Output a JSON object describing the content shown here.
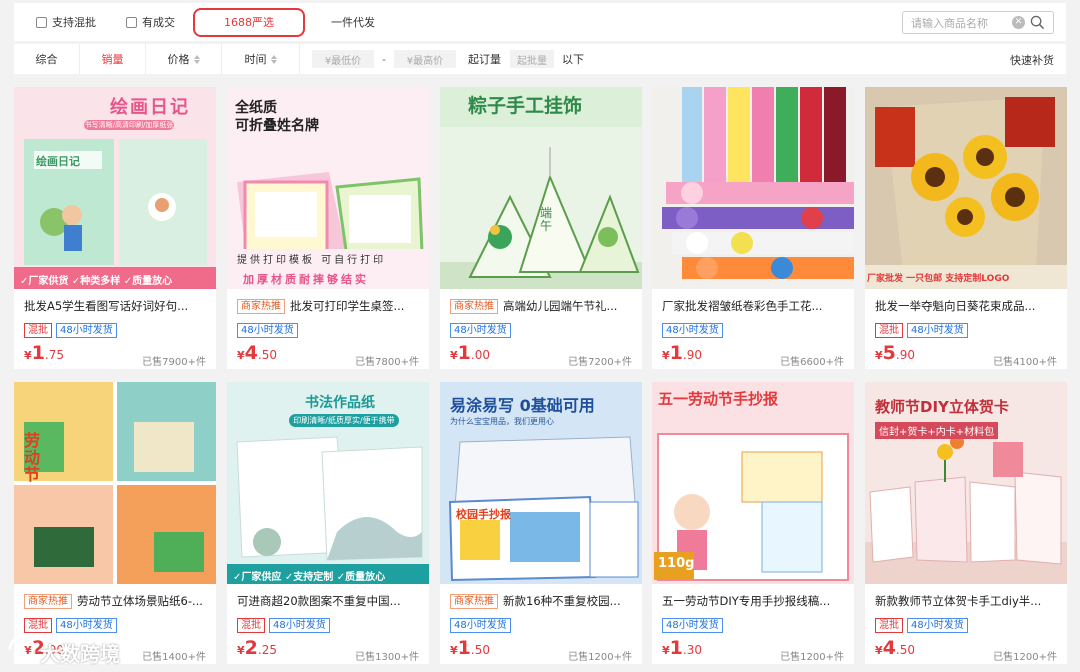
{
  "filters": {
    "mixed_batch": "支持混批",
    "has_deal": "有成交",
    "selected_tab": "1688严选",
    "dropship": "一件代发",
    "search_placeholder": "请输入商品名称"
  },
  "sort": {
    "comprehensive": "综合",
    "sales": "销量",
    "price": "价格",
    "time": "时间",
    "min_price": "¥最低价",
    "dash": "-",
    "max_price": "¥最高价",
    "moq_label": "起订量",
    "moq_placeholder": "起批量",
    "below": "以下",
    "quick_restock": "快速补货"
  },
  "products": [
    {
      "title": "批发A5学生看图写话好词好句...",
      "badge": "",
      "tags": [
        {
          "text": "混批",
          "color": "red"
        },
        {
          "text": "48小时发货",
          "color": "blue"
        }
      ],
      "price_int": "1",
      "price_dec": ".75",
      "sold": "已售7900+件",
      "image": {
        "heading": "绘画日记",
        "subtitle": "书写清晰/高清印刷/加厚纸张",
        "cover": "绘画日记",
        "footer": "✓厂家供货 ✓种类多样 ✓质量放心"
      }
    },
    {
      "title": "批发可打印学生桌签...",
      "badge": "商家热推",
      "tags": [
        {
          "text": "48小时发货",
          "color": "blue"
        }
      ],
      "price_int": "4",
      "price_dec": ".50",
      "sold": "已售7800+件",
      "image": {
        "heading": "全纸质",
        "heading2": "可折叠姓名牌",
        "footer1": "提供打印模板 可自行打印",
        "footer2": "加厚材质耐摔够结实"
      }
    },
    {
      "title": "高端幼儿园端午节礼...",
      "badge": "商家热推",
      "tags": [
        {
          "text": "48小时发货",
          "color": "blue"
        }
      ],
      "price_int": "1",
      "price_dec": ".00",
      "sold": "已售7200+件",
      "image": {
        "heading": "粽子手工挂饰",
        "pyramid": "端午"
      }
    },
    {
      "title": "厂家批发褶皱纸卷彩色手工花...",
      "badge": "",
      "tags": [
        {
          "text": "48小时发货",
          "color": "blue"
        }
      ],
      "price_int": "1",
      "price_dec": ".90",
      "sold": "已售6600+件",
      "image": {}
    },
    {
      "title": "批发一举夺魁向日葵花束成品...",
      "badge": "",
      "tags": [
        {
          "text": "混批",
          "color": "red"
        },
        {
          "text": "48小时发货",
          "color": "blue"
        }
      ],
      "price_int": "5",
      "price_dec": ".90",
      "sold": "已售4100+件",
      "image": {
        "banner": "厂家批发 一只包邮 支持定制LOGO"
      }
    },
    {
      "title": "劳动节立体场景贴纸6-...",
      "badge": "商家热推",
      "tags": [
        {
          "text": "混批",
          "color": "red"
        },
        {
          "text": "48小时发货",
          "color": "blue"
        }
      ],
      "price_int": "2",
      "price_dec": ".90",
      "sold": "已售1400+件",
      "image": {
        "panel": "劳动节"
      }
    },
    {
      "title": "可进商超20款图案不重复中国...",
      "badge": "",
      "tags": [
        {
          "text": "混批",
          "color": "red"
        },
        {
          "text": "48小时发货",
          "color": "blue"
        }
      ],
      "price_int": "2",
      "price_dec": ".25",
      "sold": "已售1300+件",
      "image": {
        "heading": "书法作品纸",
        "subtitle": "印刷清晰/纸质厚实/便于携带",
        "footer": "✓厂家供应 ✓支持定制 ✓质量放心"
      }
    },
    {
      "title": "新款16种不重复校园...",
      "badge": "商家热推",
      "tags": [
        {
          "text": "48小时发货",
          "color": "blue"
        }
      ],
      "price_int": "1",
      "price_dec": ".50",
      "sold": "已售1200+件",
      "image": {
        "heading": "易涂易写 0基础可用",
        "subtitle": "为什么宝宝用品，我们更用心",
        "board": "校园手抄报"
      }
    },
    {
      "title": "五一劳动节DIY专用手抄报线稿...",
      "badge": "",
      "tags": [
        {
          "text": "48小时发货",
          "color": "blue"
        }
      ],
      "price_int": "1",
      "price_dec": ".30",
      "sold": "已售1200+件",
      "image": {
        "heading": "五一劳动节手抄报",
        "weight": "110g"
      }
    },
    {
      "title": "新款教师节立体贺卡手工diy半...",
      "badge": "",
      "tags": [
        {
          "text": "混批",
          "color": "red"
        },
        {
          "text": "48小时发货",
          "color": "blue"
        }
      ],
      "price_int": "4",
      "price_dec": ".50",
      "sold": "已售1200+件",
      "image": {
        "heading": "教师节DIY立体贺卡",
        "subtitle": "信封+贺卡+内卡+材料包"
      }
    }
  ],
  "watermark": "大数跨境",
  "colors": {
    "accent": "#e4393c",
    "tag_blue": "#1e6fe0",
    "badge_orange": "#e05c22"
  }
}
